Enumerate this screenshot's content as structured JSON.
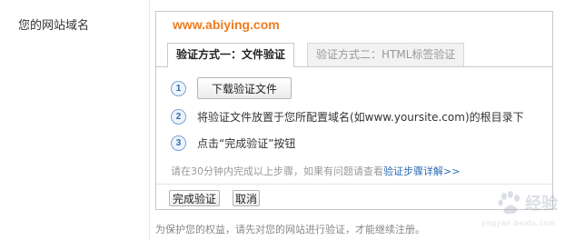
{
  "field_label": "您的网站域名",
  "domain": "www.abiying.com",
  "tabs": [
    {
      "label": "验证方式一：文件验证",
      "active": true
    },
    {
      "label": "验证方式二：HTML标签验证",
      "active": false
    }
  ],
  "steps": [
    {
      "number": "1",
      "button_label": "下载验证文件"
    },
    {
      "number": "2",
      "text": "将验证文件放置于您所配置域名(如www.yoursite.com)的根目录下"
    },
    {
      "number": "3",
      "text": "点击“完成验证”按钮"
    }
  ],
  "hint": {
    "text": "请在30分钟内完成以上步骤，如果有问题请查看",
    "link": "验证步骤详解>>"
  },
  "actions": {
    "confirm_label": "完成验证",
    "cancel_label": "取消"
  },
  "bottom_note": "为保护您的权益，请先对您的网站进行验证，才能继续注册。",
  "watermark": {
    "text": "经验",
    "sub": "jingyan.baidu.com"
  },
  "colors": {
    "domain": "#f07b1c",
    "link": "#2d6cb3",
    "step_circle": "#7aa4d6"
  }
}
